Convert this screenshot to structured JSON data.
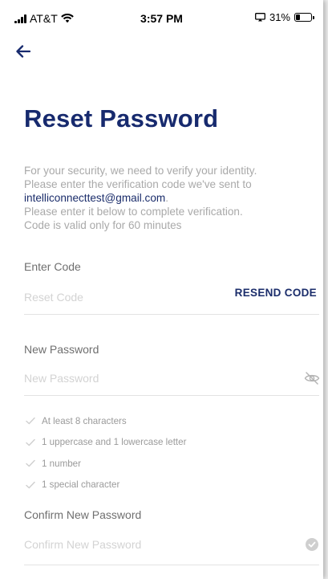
{
  "status_bar": {
    "carrier": "AT&T",
    "time": "3:57 PM",
    "battery_percent": "31%",
    "battery_level": 0.31
  },
  "header": {
    "back_icon": "arrow-left-icon"
  },
  "page": {
    "title": "Reset Password",
    "intro_line_1": "For your security, we need to verify your identity.",
    "intro_line_2": "Please enter the verification code we've sent to",
    "email": "intelliconnecttest@gmail.com",
    "email_suffix": ".",
    "intro_line_3": "Please enter it below to complete verification.",
    "intro_line_4": "Code is valid only for 60 minutes"
  },
  "code_field": {
    "label": "Enter Code",
    "placeholder": "Reset Code",
    "value": "",
    "resend_label": "RESEND CODE"
  },
  "new_password_field": {
    "label": "New Password",
    "placeholder": "New Password",
    "value": "",
    "toggle_icon": "eye-off-icon"
  },
  "requirements": [
    {
      "label": "At least 8 characters",
      "icon": "check-icon"
    },
    {
      "label": "1 uppercase and 1 lowercase letter",
      "icon": "check-icon"
    },
    {
      "label": "1 number",
      "icon": "check-icon"
    },
    {
      "label": "1 special character",
      "icon": "check-icon"
    }
  ],
  "confirm_password_field": {
    "label": "Confirm New Password",
    "placeholder": "Confirm New Password",
    "value": "",
    "status_icon": "check-circle-icon"
  },
  "colors": {
    "brand_navy": "#172a6e",
    "muted_text": "#a9a9a9",
    "placeholder": "#d3d3d3",
    "divider": "#e3e3e3"
  }
}
